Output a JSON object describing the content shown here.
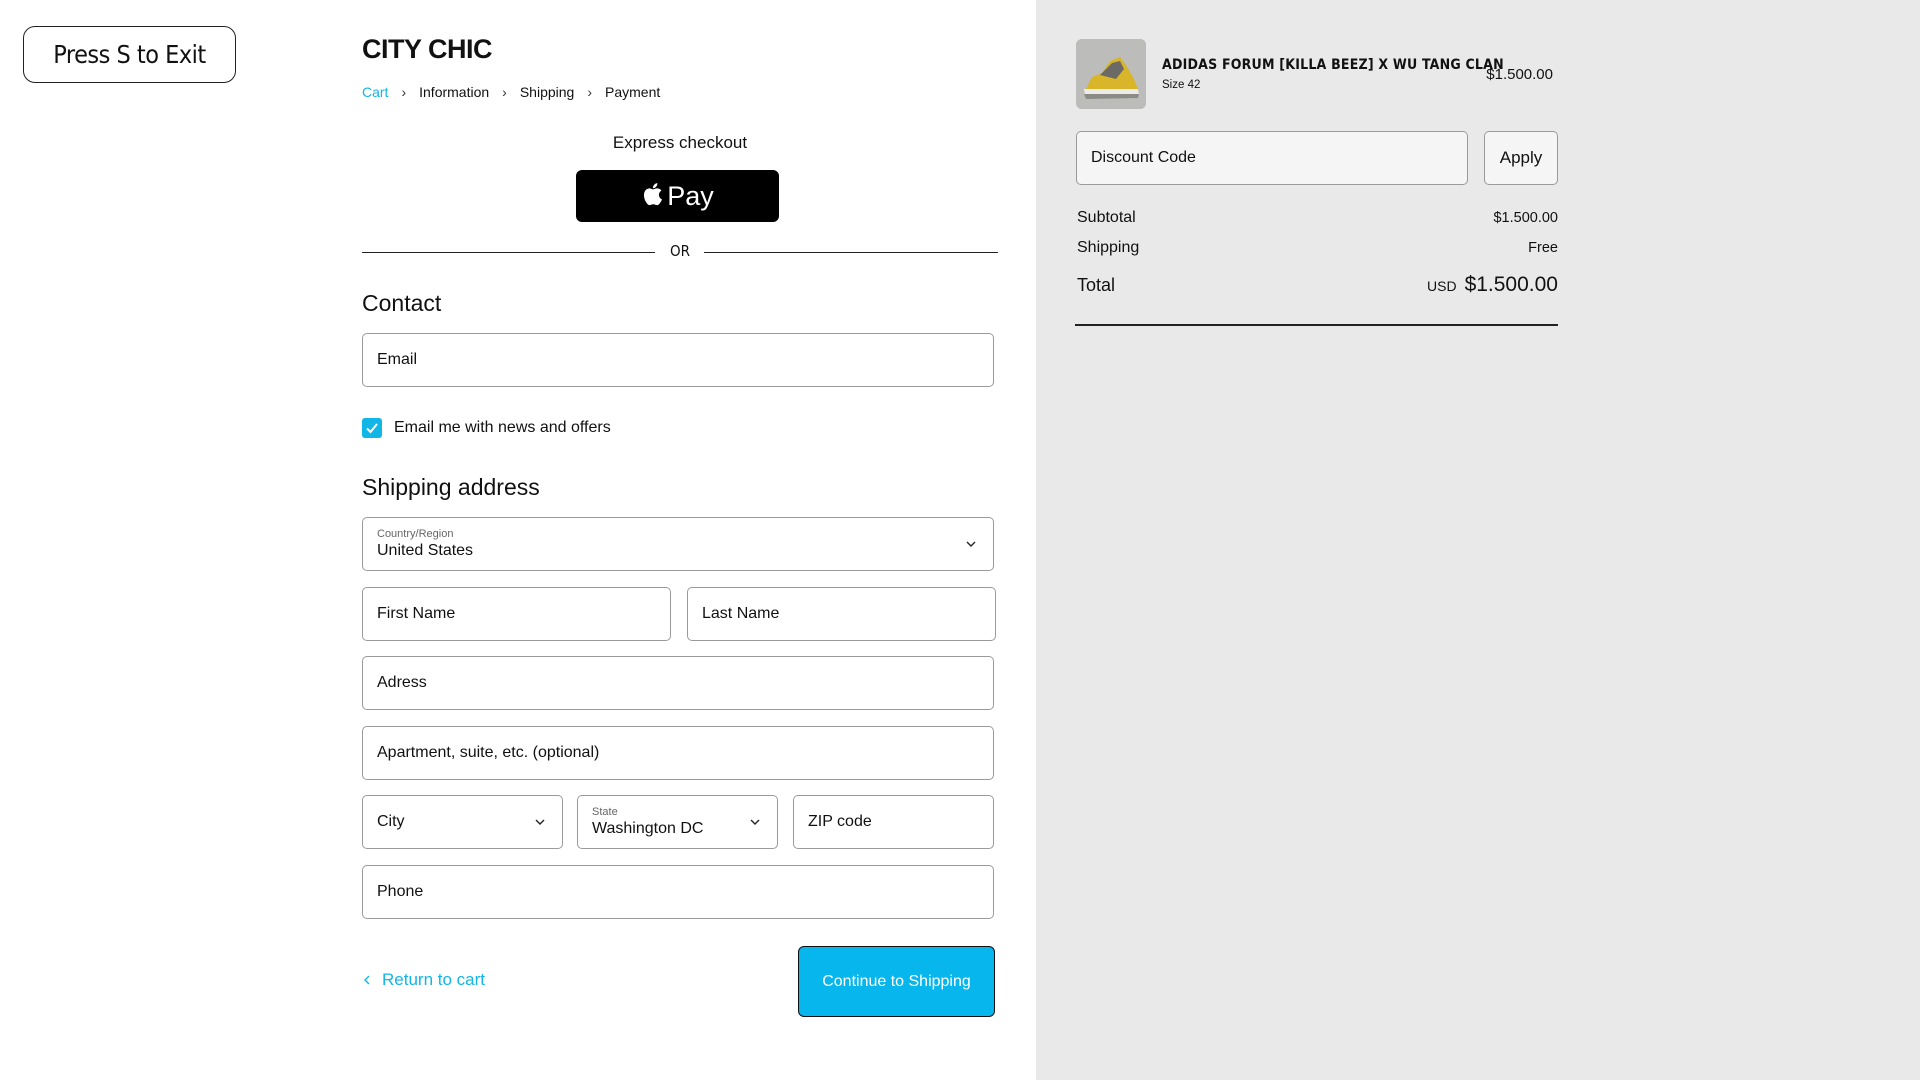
{
  "exit_button": {
    "label": "Press S to Exit"
  },
  "brand": {
    "name": "CITY CHIC"
  },
  "breadcrumb": {
    "items": [
      {
        "label": "Cart",
        "active": true
      },
      {
        "label": "Information",
        "active": false
      },
      {
        "label": "Shipping",
        "active": false
      },
      {
        "label": "Payment",
        "active": false
      }
    ],
    "separator": "›"
  },
  "express": {
    "title": "Express checkout",
    "apple_pay_label": "Pay",
    "divider_text": "OR"
  },
  "contact": {
    "heading": "Contact",
    "email_placeholder": "Email",
    "newsletter_label": "Email me with news and offers",
    "newsletter_checked": true
  },
  "shipping": {
    "heading": "Shipping address",
    "country_label": "Country/Region",
    "country_value": "United States",
    "first_name_placeholder": "First Name",
    "last_name_placeholder": "Last Name",
    "address_placeholder": "Adress",
    "apartment_placeholder": "Apartment, suite, etc. (optional)",
    "city_placeholder": "City",
    "state_label": "State",
    "state_value": "Washington DC",
    "zip_placeholder": "ZIP code",
    "phone_placeholder": "Phone"
  },
  "actions": {
    "return_label": "Return to cart",
    "continue_label": "Continue to Shipping"
  },
  "order": {
    "product_name": "ADIDAS FORUM [KILLA BEEZ] X WU TANG CLAN",
    "product_size": "Size 42",
    "product_price": "$1.500.00",
    "discount_placeholder": "Discount Code",
    "apply_label": "Apply",
    "subtotal_label": "Subtotal",
    "subtotal_value": "$1.500.00",
    "shipping_label": "Shipping",
    "shipping_value": "Free",
    "total_label": "Total",
    "total_currency": "USD",
    "total_value": "$1.500.00"
  },
  "colors": {
    "accent": "#12b6e6",
    "button_bg": "#06b6ec",
    "summary_bg": "#e9e9e9"
  },
  "icons": [
    "apple-icon",
    "chevron-right-icon",
    "chevron-down-icon",
    "chevron-left-icon",
    "checkmark-icon"
  ]
}
